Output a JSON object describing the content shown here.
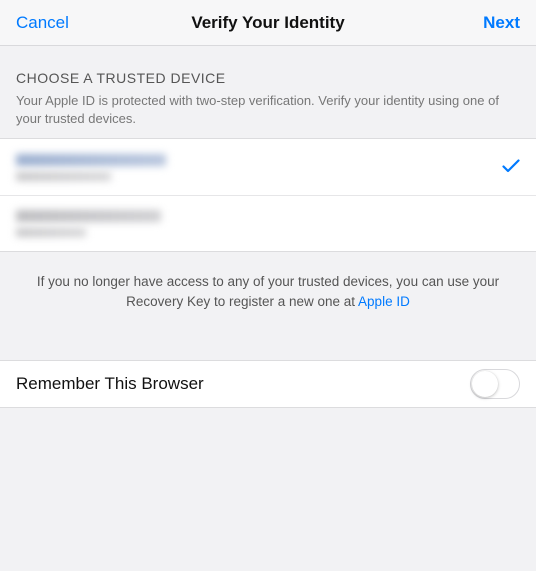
{
  "header": {
    "cancel": "Cancel",
    "title": "Verify Your Identity",
    "next": "Next"
  },
  "section": {
    "title": "CHOOSE A TRUSTED DEVICE",
    "desc": "Your Apple ID is protected with two-step verification. Verify your identity using one of your trusted devices."
  },
  "devices": [
    {
      "selected": true
    },
    {
      "selected": false
    }
  ],
  "footer": {
    "text_before": "If you no longer have access to any of your trusted devices, you can use your Recovery Key to register a new one at ",
    "link": "Apple ID"
  },
  "remember": {
    "label": "Remember This Browser",
    "on": false
  }
}
